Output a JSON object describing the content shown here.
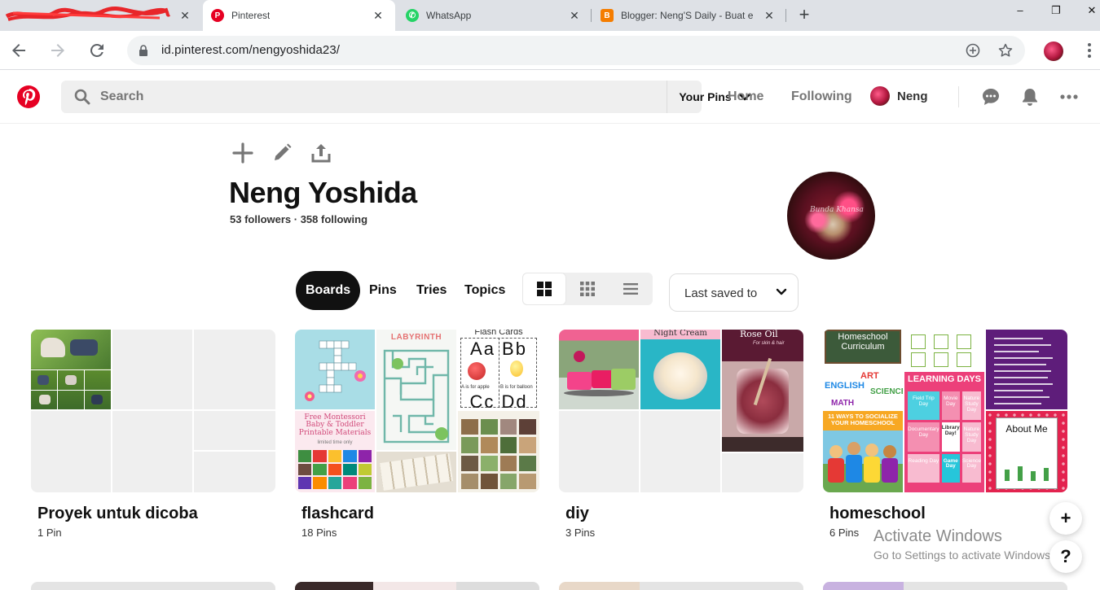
{
  "browser": {
    "tabs": [
      {
        "label": "",
        "redacted": true
      },
      {
        "label": "Pinterest",
        "active": true,
        "icon": "pinterest-icon"
      },
      {
        "label": "WhatsApp",
        "icon": "whatsapp-icon"
      },
      {
        "label": "Blogger: Neng'S Daily - Buat e",
        "icon": "blogger-icon"
      }
    ],
    "new_tab": "+",
    "window_controls": {
      "minimize": "–",
      "restore": "❐",
      "close": "✕"
    },
    "url": "id.pinterest.com/nengyoshida23/"
  },
  "header": {
    "search_placeholder": "Search",
    "your_pins_label": "Your Pins",
    "nav": {
      "home": "Home",
      "following": "Following",
      "user": "Neng"
    },
    "brand_color": "#e60023"
  },
  "profile": {
    "name": "Neng Yoshida",
    "stats": "53 followers · 358 following",
    "avatar_watermark": "Bunda Khansa"
  },
  "tabs": {
    "boards": "Boards",
    "pins": "Pins",
    "tries": "Tries",
    "topics": "Topics"
  },
  "sort": {
    "selected": "Last saved to"
  },
  "boards": [
    {
      "title": "Proyek untuk dicoba",
      "count": "1 Pin"
    },
    {
      "title": "flashcard",
      "count": "18 Pins",
      "overlays": {
        "labyrinth": "LABYRINTH",
        "flash_cards": "Flash Cards",
        "letters_a": "Aa Bb",
        "letters_c": "Cc Dd",
        "apple": "A is for apple",
        "balloon": "B is for balloon",
        "montessori": "Free Montessori Baby & Toddler Printable Materials",
        "limited": "limited time only"
      }
    },
    {
      "title": "diy",
      "count": "3 Pins",
      "overlays": {
        "night_cream": "Night Cream",
        "rose_oil": "Rose Oil",
        "rose_sub": "For skin & hair"
      }
    },
    {
      "title": "homeschool",
      "count": "6 Pins",
      "overlays": {
        "curriculum": "Homeschool Curriculum",
        "english": "ENGLISH",
        "art": "ART",
        "science": "SCIENCE",
        "math": "MATH",
        "learning_days": "LEARNING DAYS",
        "ways": "11 WAYS TO SOCIALIZE YOUR HOMESCHOOL",
        "about": "About Me",
        "library": "Library Day!",
        "game": "Game Day",
        "field_trip": "Field Trip Day",
        "movie": "Movie Day",
        "nature": "Nature Study Day",
        "documentary": "Documentary Day",
        "reading": "Reading Day",
        "science_day": "Science Day"
      }
    }
  ],
  "floating": {
    "add": "+",
    "help": "?"
  },
  "windows_notice": {
    "title": "Activate Windows",
    "subtitle": "Go to Settings to activate Windows."
  }
}
